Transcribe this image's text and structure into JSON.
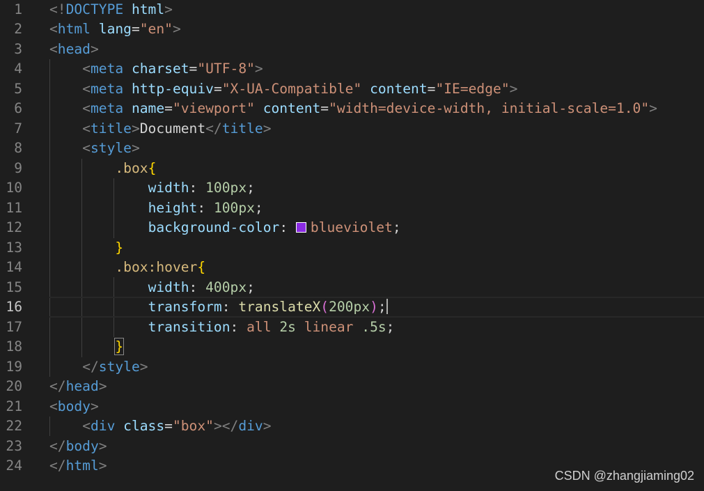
{
  "editor": {
    "lines": [
      {
        "n": "1",
        "tokens": [
          [
            "p",
            "<!"
          ],
          [
            "tag",
            "DOCTYPE"
          ],
          [
            "txt",
            " "
          ],
          [
            "attr",
            "html"
          ],
          [
            "p",
            ">"
          ]
        ]
      },
      {
        "n": "2",
        "tokens": [
          [
            "p",
            "<"
          ],
          [
            "tag",
            "html"
          ],
          [
            "txt",
            " "
          ],
          [
            "attr",
            "lang"
          ],
          [
            "txt",
            "="
          ],
          [
            "str",
            "\"en\""
          ],
          [
            "p",
            ">"
          ]
        ]
      },
      {
        "n": "3",
        "tokens": [
          [
            "p",
            "<"
          ],
          [
            "tag",
            "head"
          ],
          [
            "p",
            ">"
          ]
        ]
      },
      {
        "n": "4",
        "tokens": [
          [
            "txt",
            "    "
          ],
          [
            "p",
            "<"
          ],
          [
            "tag",
            "meta"
          ],
          [
            "txt",
            " "
          ],
          [
            "attr",
            "charset"
          ],
          [
            "txt",
            "="
          ],
          [
            "str",
            "\"UTF-8\""
          ],
          [
            "p",
            ">"
          ]
        ]
      },
      {
        "n": "5",
        "tokens": [
          [
            "txt",
            "    "
          ],
          [
            "p",
            "<"
          ],
          [
            "tag",
            "meta"
          ],
          [
            "txt",
            " "
          ],
          [
            "attr",
            "http-equiv"
          ],
          [
            "txt",
            "="
          ],
          [
            "str",
            "\"X-UA-Compatible\""
          ],
          [
            "txt",
            " "
          ],
          [
            "attr",
            "content"
          ],
          [
            "txt",
            "="
          ],
          [
            "str",
            "\"IE=edge\""
          ],
          [
            "p",
            ">"
          ]
        ]
      },
      {
        "n": "6",
        "tokens": [
          [
            "txt",
            "    "
          ],
          [
            "p",
            "<"
          ],
          [
            "tag",
            "meta"
          ],
          [
            "txt",
            " "
          ],
          [
            "attr",
            "name"
          ],
          [
            "txt",
            "="
          ],
          [
            "str",
            "\"viewport\""
          ],
          [
            "txt",
            " "
          ],
          [
            "attr",
            "content"
          ],
          [
            "txt",
            "="
          ],
          [
            "str",
            "\"width=device-width, initial-scale=1.0\""
          ],
          [
            "p",
            ">"
          ]
        ]
      },
      {
        "n": "7",
        "tokens": [
          [
            "txt",
            "    "
          ],
          [
            "p",
            "<"
          ],
          [
            "tag",
            "title"
          ],
          [
            "p",
            ">"
          ],
          [
            "txt",
            "Document"
          ],
          [
            "p",
            "</"
          ],
          [
            "tag",
            "title"
          ],
          [
            "p",
            ">"
          ]
        ]
      },
      {
        "n": "8",
        "tokens": [
          [
            "txt",
            "    "
          ],
          [
            "p",
            "<"
          ],
          [
            "tag",
            "style"
          ],
          [
            "p",
            ">"
          ]
        ]
      },
      {
        "n": "9",
        "tokens": [
          [
            "txt",
            "        "
          ],
          [
            "sel",
            ".box"
          ],
          [
            "b1",
            "{"
          ]
        ]
      },
      {
        "n": "10",
        "tokens": [
          [
            "txt",
            "            "
          ],
          [
            "prop",
            "width"
          ],
          [
            "txt",
            ": "
          ],
          [
            "num",
            "100px"
          ],
          [
            "txt",
            ";"
          ]
        ]
      },
      {
        "n": "11",
        "tokens": [
          [
            "txt",
            "            "
          ],
          [
            "prop",
            "height"
          ],
          [
            "txt",
            ": "
          ],
          [
            "num",
            "100px"
          ],
          [
            "txt",
            ";"
          ]
        ]
      },
      {
        "n": "12",
        "tokens": [
          [
            "txt",
            "            "
          ],
          [
            "prop",
            "background-color"
          ],
          [
            "txt",
            ": "
          ],
          [
            "swatch",
            "#8a2be2"
          ],
          [
            "val",
            "blueviolet"
          ],
          [
            "txt",
            ";"
          ]
        ]
      },
      {
        "n": "13",
        "tokens": [
          [
            "txt",
            "        "
          ],
          [
            "b1",
            "}"
          ]
        ]
      },
      {
        "n": "14",
        "tokens": [
          [
            "txt",
            "        "
          ],
          [
            "sel",
            ".box:hover"
          ],
          [
            "b1",
            "{"
          ]
        ]
      },
      {
        "n": "15",
        "tokens": [
          [
            "txt",
            "            "
          ],
          [
            "prop",
            "width"
          ],
          [
            "txt",
            ": "
          ],
          [
            "num",
            "400px"
          ],
          [
            "txt",
            ";"
          ]
        ]
      },
      {
        "n": "16",
        "tokens": [
          [
            "txt",
            "            "
          ],
          [
            "prop",
            "transform"
          ],
          [
            "txt",
            ": "
          ],
          [
            "fn",
            "translateX"
          ],
          [
            "b2",
            "("
          ],
          [
            "num",
            "200px"
          ],
          [
            "b2",
            ")"
          ],
          [
            "txt",
            ";"
          ],
          [
            "cursor",
            ""
          ]
        ]
      },
      {
        "n": "17",
        "tokens": [
          [
            "txt",
            "            "
          ],
          [
            "prop",
            "transition"
          ],
          [
            "txt",
            ": "
          ],
          [
            "val",
            "all"
          ],
          [
            "txt",
            " "
          ],
          [
            "num",
            "2s"
          ],
          [
            "txt",
            " "
          ],
          [
            "val",
            "linear"
          ],
          [
            "txt",
            " "
          ],
          [
            "num",
            ".5s"
          ],
          [
            "txt",
            ";"
          ]
        ]
      },
      {
        "n": "18",
        "tokens": [
          [
            "txt",
            "        "
          ],
          [
            "b1m",
            "}"
          ]
        ]
      },
      {
        "n": "19",
        "tokens": [
          [
            "txt",
            "    "
          ],
          [
            "p",
            "</"
          ],
          [
            "tag",
            "style"
          ],
          [
            "p",
            ">"
          ]
        ]
      },
      {
        "n": "20",
        "tokens": [
          [
            "p",
            "</"
          ],
          [
            "tag",
            "head"
          ],
          [
            "p",
            ">"
          ]
        ]
      },
      {
        "n": "21",
        "tokens": [
          [
            "p",
            "<"
          ],
          [
            "tag",
            "body"
          ],
          [
            "p",
            ">"
          ]
        ]
      },
      {
        "n": "22",
        "tokens": [
          [
            "txt",
            "    "
          ],
          [
            "p",
            "<"
          ],
          [
            "tag",
            "div"
          ],
          [
            "txt",
            " "
          ],
          [
            "attr",
            "class"
          ],
          [
            "txt",
            "="
          ],
          [
            "str",
            "\"box\""
          ],
          [
            "p",
            "></"
          ],
          [
            "tag",
            "div"
          ],
          [
            "p",
            ">"
          ]
        ]
      },
      {
        "n": "23",
        "tokens": [
          [
            "p",
            "</"
          ],
          [
            "tag",
            "body"
          ],
          [
            "p",
            ">"
          ]
        ]
      },
      {
        "n": "24",
        "tokens": [
          [
            "p",
            "</"
          ],
          [
            "tag",
            "html"
          ],
          [
            "p",
            ">"
          ]
        ]
      }
    ],
    "active_line": "16",
    "icons": {
      "color_swatch": "color-swatch-icon"
    },
    "colors": {
      "swatch": "#8a2be2"
    }
  },
  "watermark": {
    "text": "CSDN @zhangjiaming02"
  }
}
